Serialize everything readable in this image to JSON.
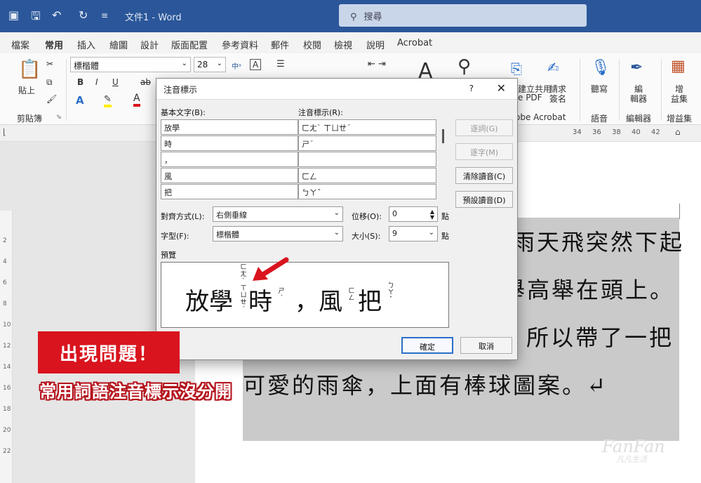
{
  "titlebar": {
    "doc_title": "文件1 - Word",
    "search_placeholder": "搜尋"
  },
  "menu": [
    "檔案",
    "常用",
    "插入",
    "繪圖",
    "設計",
    "版面配置",
    "參考資料",
    "郵件",
    "校閱",
    "檢視",
    "說明",
    "Acrobat"
  ],
  "ribbon": {
    "paste": "貼上",
    "clipboard": "剪貼簿",
    "font_name": "標楷體",
    "font_size": "28",
    "bold": "B",
    "italic": "I",
    "underline": "U",
    "strike": "ab",
    "font_color_letter": "A",
    "pdf_top": "建立共用",
    "pdf_bottom": "e PDF",
    "sign_top": "請求",
    "sign_bottom": "簽名",
    "acrobat_group": "obe Acrobat",
    "dictate": "聽寫",
    "voice_group": "語音",
    "editor_top": "編",
    "editor_bottom": "輯器",
    "editor_group": "編輯器",
    "addin_top": "增",
    "addin_bottom": "益集",
    "addin_group": "增益集"
  },
  "ruler": {
    "h": [
      "34",
      "36",
      "38",
      "40",
      "42"
    ],
    "v": [
      "2",
      "4",
      "6",
      "8",
      "10",
      "12",
      "14",
      "16",
      "18",
      "20",
      "22"
    ]
  },
  "document": {
    "line1": "雨天飛突然下起",
    "line2": "舉高舉在頭上。",
    "line3": "所以帶了一把",
    "line4": "可愛的雨傘，上面有棒球圖案。↵"
  },
  "dialog": {
    "title": "注音標示",
    "help": "?",
    "close": "✕",
    "base_label": "基本文字(B):",
    "ruby_label": "注音標示(R):",
    "rows": [
      {
        "base": "放學",
        "ruby": "ㄈㄤˋ ㄒㄩㄝˊ"
      },
      {
        "base": "時",
        "ruby": "ㄕˊ"
      },
      {
        "base": "，",
        "ruby": ""
      },
      {
        "base": "風",
        "ruby": "ㄈㄥ"
      },
      {
        "base": "把",
        "ruby": "ㄅㄚˇ"
      }
    ],
    "buttons": {
      "group": "逐詞(G)",
      "mono": "逐字(M)",
      "clear": "清除讀音(C)",
      "default": "預設讀音(D)",
      "ok": "確定",
      "cancel": "取消"
    },
    "align_label": "對齊方式(L):",
    "align_value": "右側垂線",
    "offset_label": "位移(O):",
    "offset_value": "0",
    "offset_unit": "點",
    "font_label": "字型(F):",
    "font_value": "標楷體",
    "size_label": "大小(S):",
    "size_value": "9",
    "size_unit": "點",
    "preview_label": "預覽",
    "preview": {
      "w1": "放學",
      "w2": "時",
      "w3": "，",
      "w4": "風",
      "w5": "把",
      "z1": [
        "ㄈ",
        "ㄤ",
        "ˋ",
        "ㄒ",
        "ㄩ",
        "ㄝ",
        "ˊ"
      ],
      "z2": [
        "ㄕ",
        "ˊ"
      ],
      "z4": [
        "ㄈ",
        "ㄥ"
      ],
      "z5": [
        "ㄅ",
        "ㄚ",
        "ˇ"
      ]
    }
  },
  "annotation": {
    "headline": "出現問題！",
    "subtitle": "常用詞語注音標示沒分開",
    "arrow_color": "#d9141e"
  },
  "watermark": {
    "main": "FanFan",
    "sub": "凡凡生活"
  }
}
